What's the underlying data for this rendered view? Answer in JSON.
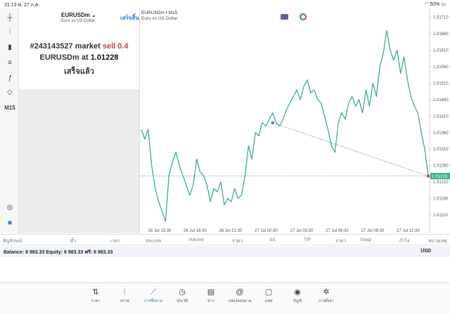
{
  "status_bar": {
    "time": "21:13",
    "date": "พ. 27 ก.ค.",
    "battery": "50%"
  },
  "left_toolbar": {
    "tools": [
      "crosshair-icon",
      "bar-chart-icon",
      "candles-icon",
      "indicators-icon",
      "function-icon",
      "objects-icon"
    ],
    "timeframe": "M15"
  },
  "trade_panel": {
    "symbol": "EURUSDm",
    "symbol_desc": "Euro vs US Dollar",
    "done_label": "เสร็จสิ้น",
    "order_id": "#243143527",
    "order_type": "market",
    "order_side": "sell 0.4",
    "order_symbol": "EURUSDm at",
    "order_price": "1.01228",
    "order_status": "เสร็จแล้ว"
  },
  "chart_data": {
    "type": "line",
    "symbol_title": "EURUSDm • M15",
    "symbol_desc": "Euro vs US Dollar",
    "line_color": "#3bb08f",
    "ylim": [
      1.0108,
      1.0172
    ],
    "y_ticks": [
      "1.01710",
      "1.01660",
      "1.01610",
      "1.01560",
      "1.01510",
      "1.01460",
      "1.01410",
      "1.01360",
      "1.01310",
      "1.01260",
      "1.01210",
      "1.01160",
      "1.01110"
    ],
    "x_ticks": [
      "26 Jul 15:30",
      "26 Jul 18:30",
      "26 Jul 21:30",
      "27 Jul 00:30",
      "27 Jul 03:30",
      "27 Jul 06:30",
      "27 Jul 09:30",
      "27 Jul 12:30"
    ],
    "x_range": [
      "26 Jul 13:00",
      "27 Jul 13:45"
    ],
    "current_price": "1.01228",
    "values": [
      1.0137,
      1.0134,
      1.0137,
      1.0126,
      1.0119,
      1.0115,
      1.0112,
      1.0109,
      1.0123,
      1.0127,
      1.013,
      1.0126,
      1.0123,
      1.012,
      1.0117,
      1.012,
      1.0128,
      1.0124,
      1.0123,
      1.012,
      1.0115,
      1.0119,
      1.0118,
      1.0121,
      1.0114,
      1.0116,
      1.0115,
      1.0119,
      1.0116,
      1.0117,
      1.0123,
      1.0132,
      1.0128,
      1.0136,
      1.0135,
      1.0139,
      1.0138,
      1.014,
      1.0142,
      1.0139,
      1.0138,
      1.014,
      1.0143,
      1.0145,
      1.0147,
      1.0149,
      1.0146,
      1.015,
      1.0152,
      1.0148,
      1.0149,
      1.0146,
      1.0145,
      1.0141,
      1.0137,
      1.0132,
      1.013,
      1.0139,
      1.0142,
      1.014,
      1.0145,
      1.0147,
      1.0144,
      1.0146,
      1.0142,
      1.0149,
      1.0144,
      1.0151,
      1.0147,
      1.0156,
      1.016,
      1.0167,
      1.0161,
      1.0158,
      1.0161,
      1.0154,
      1.0159,
      1.0152,
      1.0147,
      1.0144,
      1.0142,
      1.0136,
      1.0131,
      1.01228
    ],
    "trade_entry": {
      "index": 38,
      "price": 1.0139
    },
    "trade_exit": {
      "index": 83,
      "price": 1.01228
    }
  },
  "columns": [
    "สัญลักษณ์",
    "ตั๋ว",
    "เวลา",
    "ประเภท",
    "Volume",
    "ราคา",
    "S/L",
    "T/P",
    "ราคา",
    "Swap",
    "กำไร",
    "หมายเหตุ"
  ],
  "balance": {
    "text": "Balance: 6 983.33  Equity: 6 983.33  ฟรี: 6 983.33",
    "currency": "USD"
  },
  "tabs": [
    {
      "label": "ราคา",
      "icon": "quotes-icon"
    },
    {
      "label": "กราฟ",
      "icon": "chart-icon"
    },
    {
      "label": "การซื้อขาย",
      "icon": "trade-icon"
    },
    {
      "label": "ประวัติ",
      "icon": "history-icon"
    },
    {
      "label": "ข่าว",
      "icon": "news-icon"
    },
    {
      "label": "กล่องจดหมาย",
      "icon": "mailbox-icon"
    },
    {
      "label": "แชท",
      "icon": "chat-icon"
    },
    {
      "label": "บัญชี",
      "icon": "account-icon"
    },
    {
      "label": "การตั้งค่า",
      "icon": "settings-icon"
    }
  ]
}
